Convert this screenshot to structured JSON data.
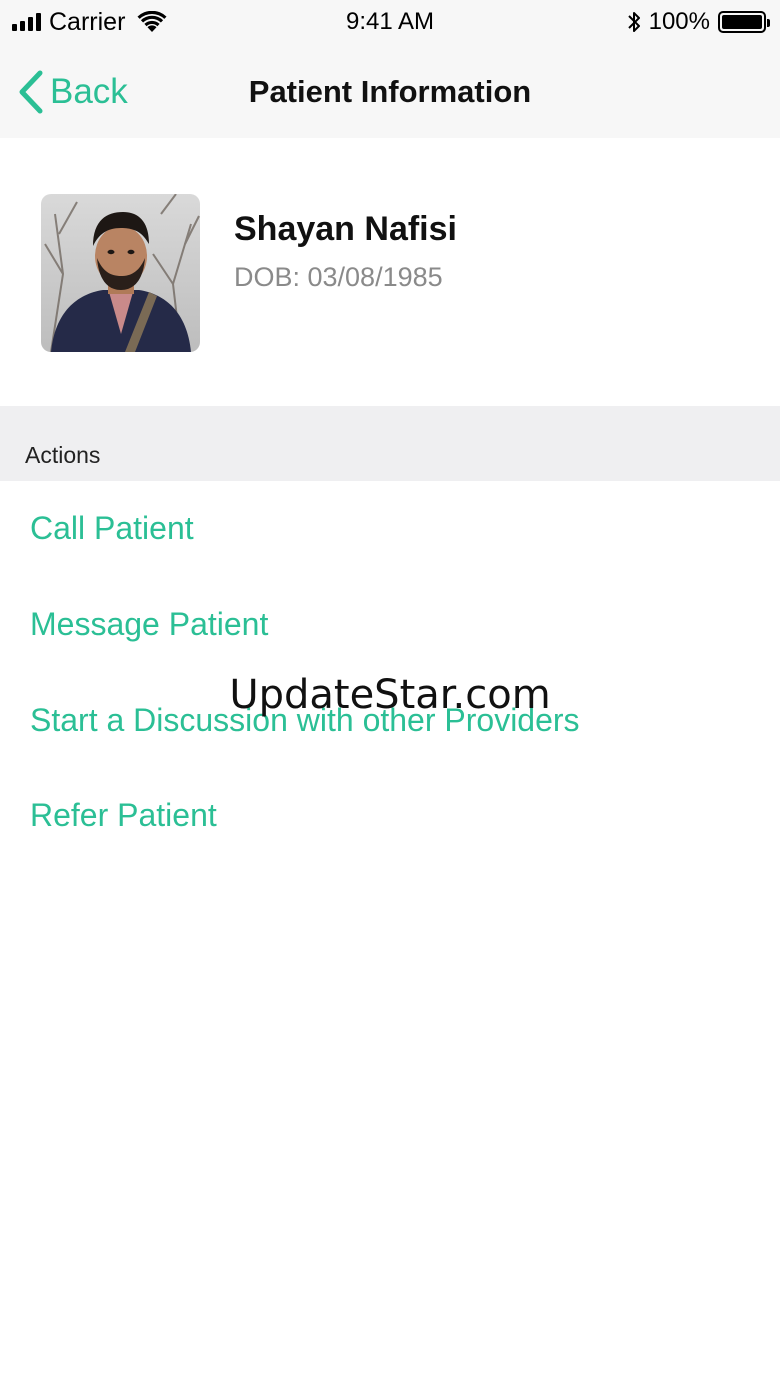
{
  "status_bar": {
    "carrier": "Carrier",
    "time": "9:41 AM",
    "battery": "100%"
  },
  "nav": {
    "back_label": "Back",
    "title": "Patient Information"
  },
  "patient": {
    "name": "Shayan Nafisi",
    "dob": "DOB: 03/08/1985"
  },
  "actions": {
    "section_title": "Actions",
    "items": [
      {
        "label": "Call Patient"
      },
      {
        "label": "Message Patient"
      },
      {
        "label": "Start a Discussion with other Providers"
      },
      {
        "label": "Refer Patient"
      }
    ]
  },
  "watermark": "UpdateStar.com",
  "colors": {
    "accent": "#2bbf95",
    "bar_background": "#f7f7f7",
    "section_background": "#efeff1",
    "secondary_text": "#8a8a8a"
  }
}
